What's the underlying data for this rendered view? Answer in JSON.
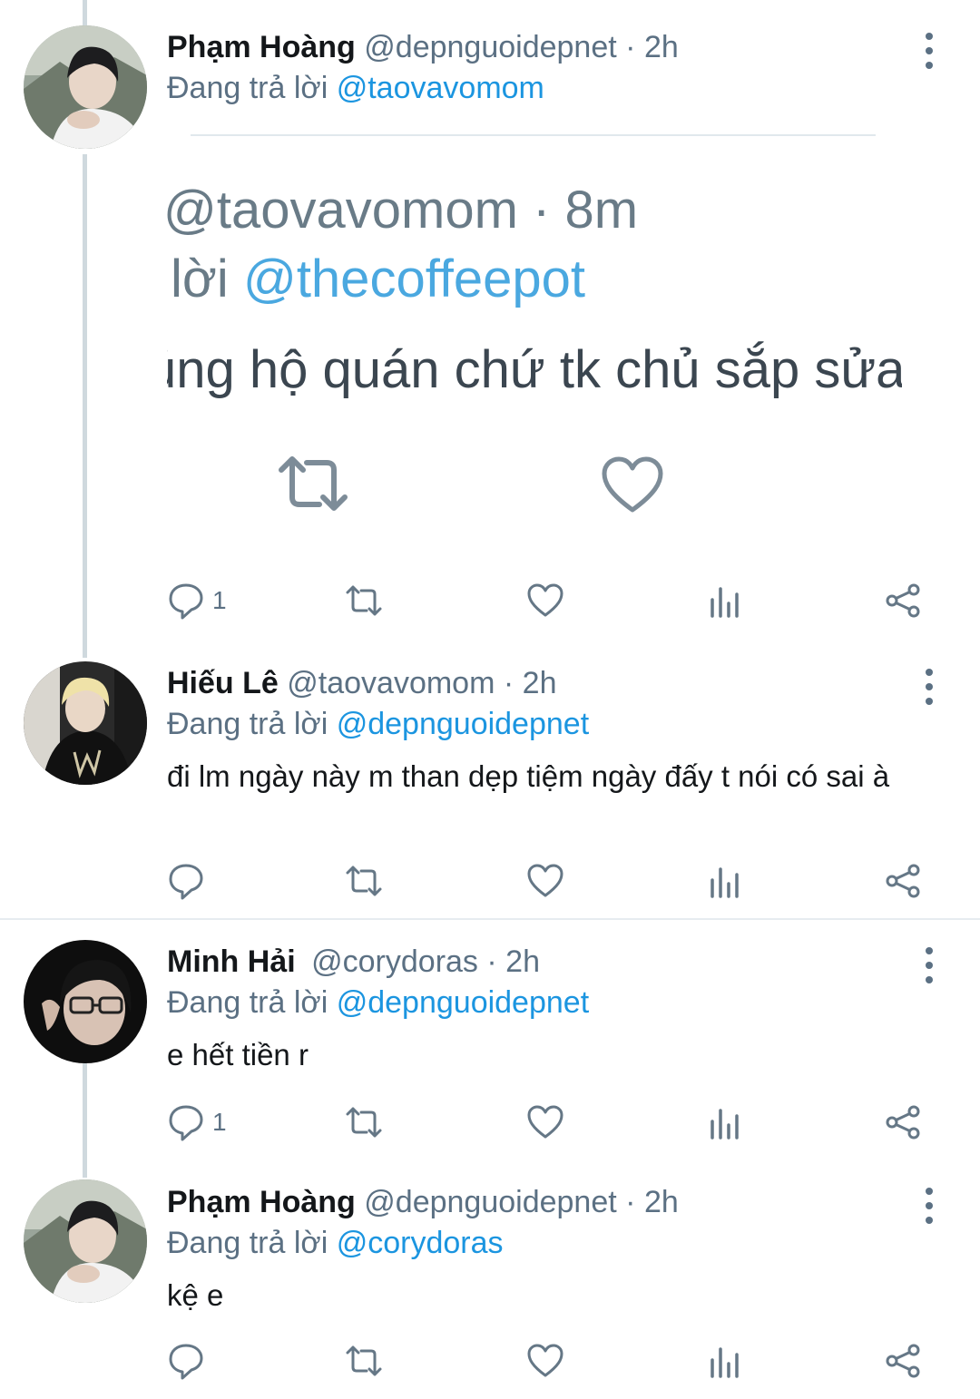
{
  "colors": {
    "accent": "#1b95e0",
    "secondary_text": "#5b7083",
    "thread_line": "#cfd9de"
  },
  "tweets": [
    {
      "name": "Phạm Hoàng",
      "handle": "@depnguoidepnet",
      "sep": "·",
      "time": "2h",
      "reply_prefix": "Đang trả lời",
      "reply_to": "@taovavomom",
      "body": "",
      "embed": {
        "line1": "@taovavomom · 8m",
        "line2_prefix": "lời",
        "line2_mention": "@thecoffeepot",
        "line3": "ủng hộ quán chứ tk chủ sắp sửa",
        "icons": [
          "retweet-icon",
          "heart-icon"
        ]
      },
      "reply_count": "1"
    },
    {
      "name": "Hiếu Lê",
      "handle": "@taovavomom",
      "sep": "·",
      "time": "2h",
      "reply_prefix": "Đang trả lời",
      "reply_to": "@depnguoidepnet",
      "body": "đi lm ngày này m than dẹp tiệm ngày đấy t nói có sai à",
      "reply_count": ""
    },
    {
      "name": "Minh Hải",
      "handle": "@corydoras",
      "sep": "·",
      "time": "2h",
      "reply_prefix": "Đang trả lời",
      "reply_to": "@depnguoidepnet",
      "body": "e hết tiền r",
      "reply_count": "1"
    },
    {
      "name": "Phạm Hoàng",
      "handle": "@depnguoidepnet",
      "sep": "·",
      "time": "2h",
      "reply_prefix": "Đang trả lời",
      "reply_to": "@corydoras",
      "body": "kệ e",
      "reply_count": ""
    }
  ],
  "action_icons": [
    "reply-icon",
    "retweet-icon",
    "like-icon",
    "analytics-icon",
    "share-icon"
  ]
}
